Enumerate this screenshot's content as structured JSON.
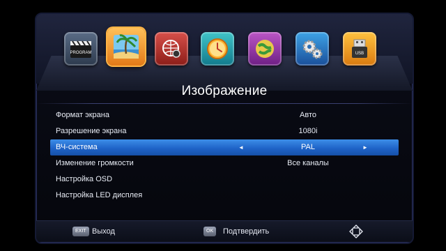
{
  "menu_bar": {
    "icons": [
      {
        "name": "program-icon",
        "caption": "PROGRAM"
      },
      {
        "name": "image-icon"
      },
      {
        "name": "search-icon"
      },
      {
        "name": "time-icon"
      },
      {
        "name": "option-icon"
      },
      {
        "name": "system-icon"
      },
      {
        "name": "usb-icon",
        "caption": "USB"
      }
    ],
    "selected_index": 1
  },
  "page": {
    "title": "Изображение"
  },
  "settings": [
    {
      "label": "Формат экрана",
      "value": "Авто"
    },
    {
      "label": "Разрешение экрана",
      "value": "1080i"
    },
    {
      "label": "ВЧ-система",
      "value": "PAL",
      "left_arrow": "◄",
      "right_arrow": "►"
    },
    {
      "label": "Изменение громкости",
      "value": "Все каналы"
    },
    {
      "label": "Настройка OSD",
      "value": ""
    },
    {
      "label": "Настройка LED дисплея",
      "value": ""
    }
  ],
  "active_setting_index": 2,
  "footer": {
    "exit_key": "EXIT",
    "exit_label": "Выход",
    "ok_key": "OK",
    "ok_label": "Подтвердить"
  },
  "colors": {
    "highlight": "#2f7ddc",
    "selected_icon_border": "#ffb445",
    "text": "#e8ecf5"
  }
}
